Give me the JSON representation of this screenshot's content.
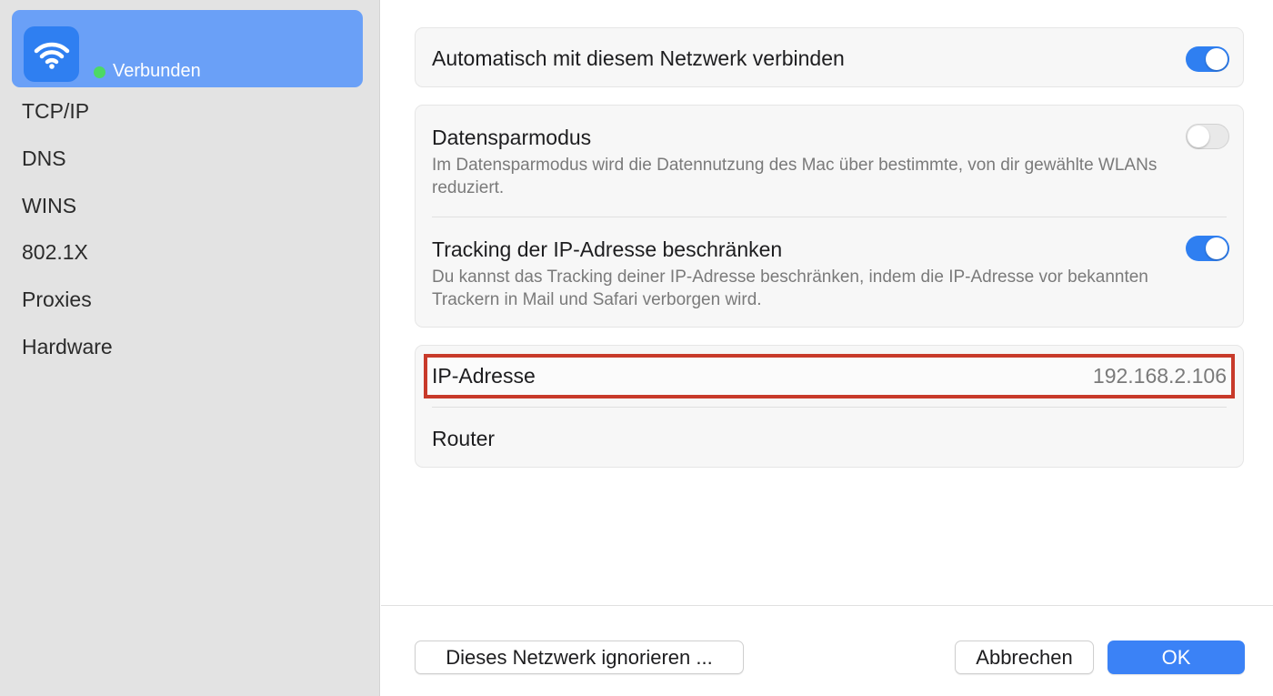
{
  "sidebar": {
    "network": {
      "icon": "wifi-icon",
      "status_label": "Verbunden"
    },
    "items": [
      {
        "label": "TCP/IP"
      },
      {
        "label": "DNS"
      },
      {
        "label": "WINS"
      },
      {
        "label": "802.1X"
      },
      {
        "label": "Proxies"
      },
      {
        "label": "Hardware"
      }
    ]
  },
  "settings": {
    "auto_join": {
      "label": "Automatisch mit diesem Netzwerk verbinden",
      "enabled": true
    },
    "low_data": {
      "label": "Datensparmodus",
      "description": "Im Datensparmodus wird die Datennutzung des Mac über bestimmte, von dir gewählte WLANs reduziert.",
      "enabled": false
    },
    "limit_ip_tracking": {
      "label": "Tracking der IP-Adresse beschränken",
      "description": "Du kannst das Tracking deiner IP-Adresse beschränken, indem die IP-Adresse vor bekannten Trackern in Mail und Safari verborgen wird.",
      "enabled": true
    }
  },
  "info": {
    "ip_address": {
      "label": "IP-Adresse",
      "value": "192.168.2.106"
    },
    "router": {
      "label": "Router",
      "value": ""
    }
  },
  "footer": {
    "forget_label": "Dieses Netzwerk ignorieren ...",
    "cancel_label": "Abbrechen",
    "ok_label": "OK"
  },
  "colors": {
    "accent": "#2f7ff1",
    "selected_item": "#6aa0f7",
    "status_connected": "#4cd964",
    "highlight_border": "#c83a2a"
  }
}
